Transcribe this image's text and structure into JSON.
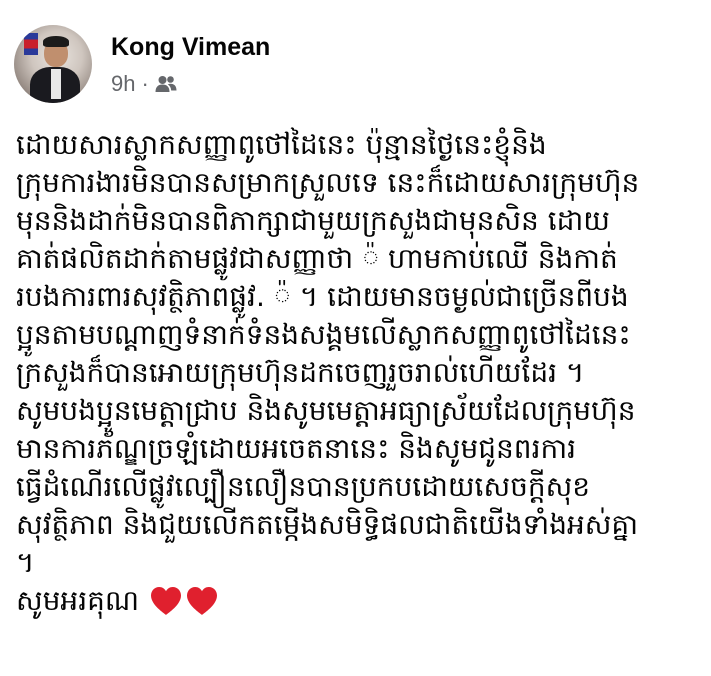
{
  "post": {
    "author_name": "Kong Vimean",
    "timestamp": "9h",
    "separator": "·",
    "audience_icon": "friends-icon",
    "lines": [
      "ដោយសារស្លាកសញ្ញាពូថៅដៃនេះ ប៉ុន្មានថ្ងៃនេះខ្ញុំនិង",
      "ក្រុមការងារមិនបានសម្រាកស្រួលទេ  នេះក៏ដោយសារក្រុមហ៊ុន",
      "មុននិងដាក់មិនបានពិភាក្សាជាមួយក្រសួងជាមុនសិន  ដោយ",
      "គាត់ផលិតដាក់តាមផ្លូវជាសញ្ញាថា ៉ ហាមកាប់ឈើ និងកាត់",
      "របងការពារសុវត្ថិភាពផ្លូវ. ៉  ។ ដោយមានចម្ងល់ជាច្រើនពីបង",
      "ប្អូនតាមបណ្តាញទំនាក់ទំនងសង្គមលើស្លាកសញ្ញាពូថៅដៃនេះ",
      "ក្រសួងក៏បានអោយក្រុមហ៊ុនដកចេញរួចរាល់ហើយដែរ ។",
      "សូមបងប្អូនមេត្តាជ្រាប  និងសូមមេត្តាអធ្យាស្រ័យដែលក្រុមហ៊ុន",
      "មានការភ័ណ្ឌច្រឡំដោយអចេតនានេះ និងសូមជូនពរការ",
      "ធ្វើដំណើរលើផ្លូវល្បឿនលឿនបានប្រកបដោយសេចក្តីសុខ",
      "សុវត្ថិភាព  និងជួយលើកតម្កើងសមិទ្ធិផលជាតិយើងទាំងអស់គ្នា",
      "។"
    ],
    "closing": "សូមអរគុណ",
    "closing_icons": [
      "heart-icon",
      "heart-icon"
    ],
    "heart_color": "#e0202e"
  }
}
